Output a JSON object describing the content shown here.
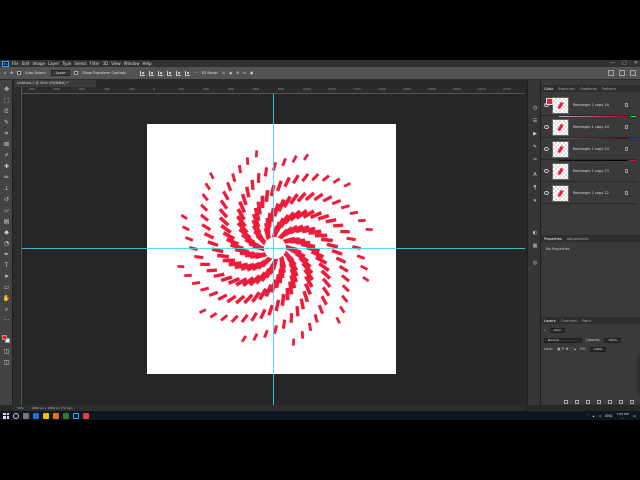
{
  "menu": {
    "app_logo": "Ps",
    "items": [
      "File",
      "Edit",
      "Image",
      "Layer",
      "Type",
      "Select",
      "Filter",
      "3D",
      "View",
      "Window",
      "Help"
    ],
    "window_controls": [
      "—",
      "□",
      "✕"
    ]
  },
  "options": {
    "auto_select_label": "Auto-Select:",
    "auto_select_value": "Layer",
    "show_transform_label": "Show Transform Controls",
    "mode_3d_label": "3D Mode:"
  },
  "document": {
    "tab_title": "Untitled-1 @ 50% (RGB/8#) *",
    "status_zoom": "50%",
    "status_info": "1800 px x 1800 px (72 ppi)"
  },
  "ruler": {
    "top_labels": [
      "-750",
      "-650",
      "-500",
      "-350",
      "-150",
      "0",
      "150",
      "350",
      "500",
      "650",
      "850",
      "1000",
      "1150",
      "1350",
      "1500",
      "1650",
      "1850",
      "2000",
      "2150",
      "2300"
    ]
  },
  "canvas": {
    "artwork": "spiral-flower-shape",
    "shape_color": "#ed1c3a",
    "background_color": "#ffffff",
    "guide_color": "#3cd7f0",
    "arm_count": 12
  },
  "color_panel": {
    "tabs": [
      "Color",
      "Swatches",
      "Gradients",
      "Patterns"
    ],
    "foreground": "#ed1c3a",
    "background": "#ffffff"
  },
  "properties_panel": {
    "tabs": [
      "Properties",
      "Adjustments"
    ],
    "empty_text": "No Properties"
  },
  "layers_panel": {
    "tabs": [
      "Layers",
      "Channels",
      "Paths"
    ],
    "kind_filter": "Kind",
    "blend_mode": "Normal",
    "opacity_label": "Opacity:",
    "opacity_value": "100%",
    "lock_label": "Lock:",
    "fill_label": "Fill:",
    "fill_value": "100%",
    "layers": [
      {
        "name": "Rectangle 1 copy 24"
      },
      {
        "name": "Rectangle 1 copy 24"
      },
      {
        "name": "Rectangle 1 copy 24"
      },
      {
        "name": "Rectangle 1 copy 23"
      },
      {
        "name": "Rectangle 1 copy 22"
      }
    ]
  },
  "taskbar": {
    "language": "ENG",
    "time": "7:55 PM",
    "date": "..."
  }
}
